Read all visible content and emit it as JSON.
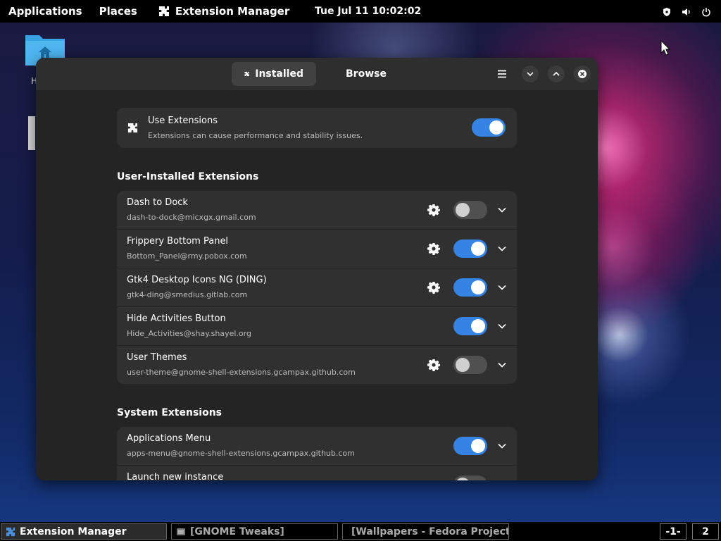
{
  "topbar": {
    "applications": "Applications",
    "places": "Places",
    "app_name": "Extension Manager",
    "clock": "Tue Jul 11  10:02:02"
  },
  "desktop": {
    "home_label": "H"
  },
  "window": {
    "tabs": {
      "installed": "Installed",
      "browse": "Browse"
    },
    "use_extensions": {
      "title": "Use Extensions",
      "subtitle": "Extensions can cause performance and stability issues.",
      "enabled": true
    },
    "user_section_title": "User-Installed Extensions",
    "user_extensions": [
      {
        "name": "Dash to Dock",
        "id": "dash-to-dock@micxgx.gmail.com",
        "has_settings": true,
        "enabled": false
      },
      {
        "name": "Frippery Bottom Panel",
        "id": "Bottom_Panel@rmy.pobox.com",
        "has_settings": true,
        "enabled": true
      },
      {
        "name": "Gtk4 Desktop Icons NG (DING)",
        "id": "gtk4-ding@smedius.gitlab.com",
        "has_settings": true,
        "enabled": true
      },
      {
        "name": "Hide Activities Button",
        "id": "Hide_Activities@shay.shayel.org",
        "has_settings": false,
        "enabled": true
      },
      {
        "name": "User Themes",
        "id": "user-theme@gnome-shell-extensions.gcampax.github.com",
        "has_settings": true,
        "enabled": false
      }
    ],
    "system_section_title": "System Extensions",
    "system_extensions": [
      {
        "name": "Applications Menu",
        "id": "apps-menu@gnome-shell-extensions.gcampax.github.com",
        "has_settings": false,
        "enabled": true
      },
      {
        "name": "Launch new instance",
        "id": "",
        "has_settings": false,
        "enabled": false
      }
    ]
  },
  "taskbar": {
    "tasks": [
      {
        "label": "Extension Manager"
      },
      {
        "label": "[GNOME Tweaks]"
      },
      {
        "label": "[Wallpapers - Fedora Project ..."
      }
    ],
    "workspaces": [
      "-1-",
      "2"
    ]
  },
  "colors": {
    "accent": "#3584e4",
    "window_bg": "#242424",
    "card_bg": "#303030"
  }
}
